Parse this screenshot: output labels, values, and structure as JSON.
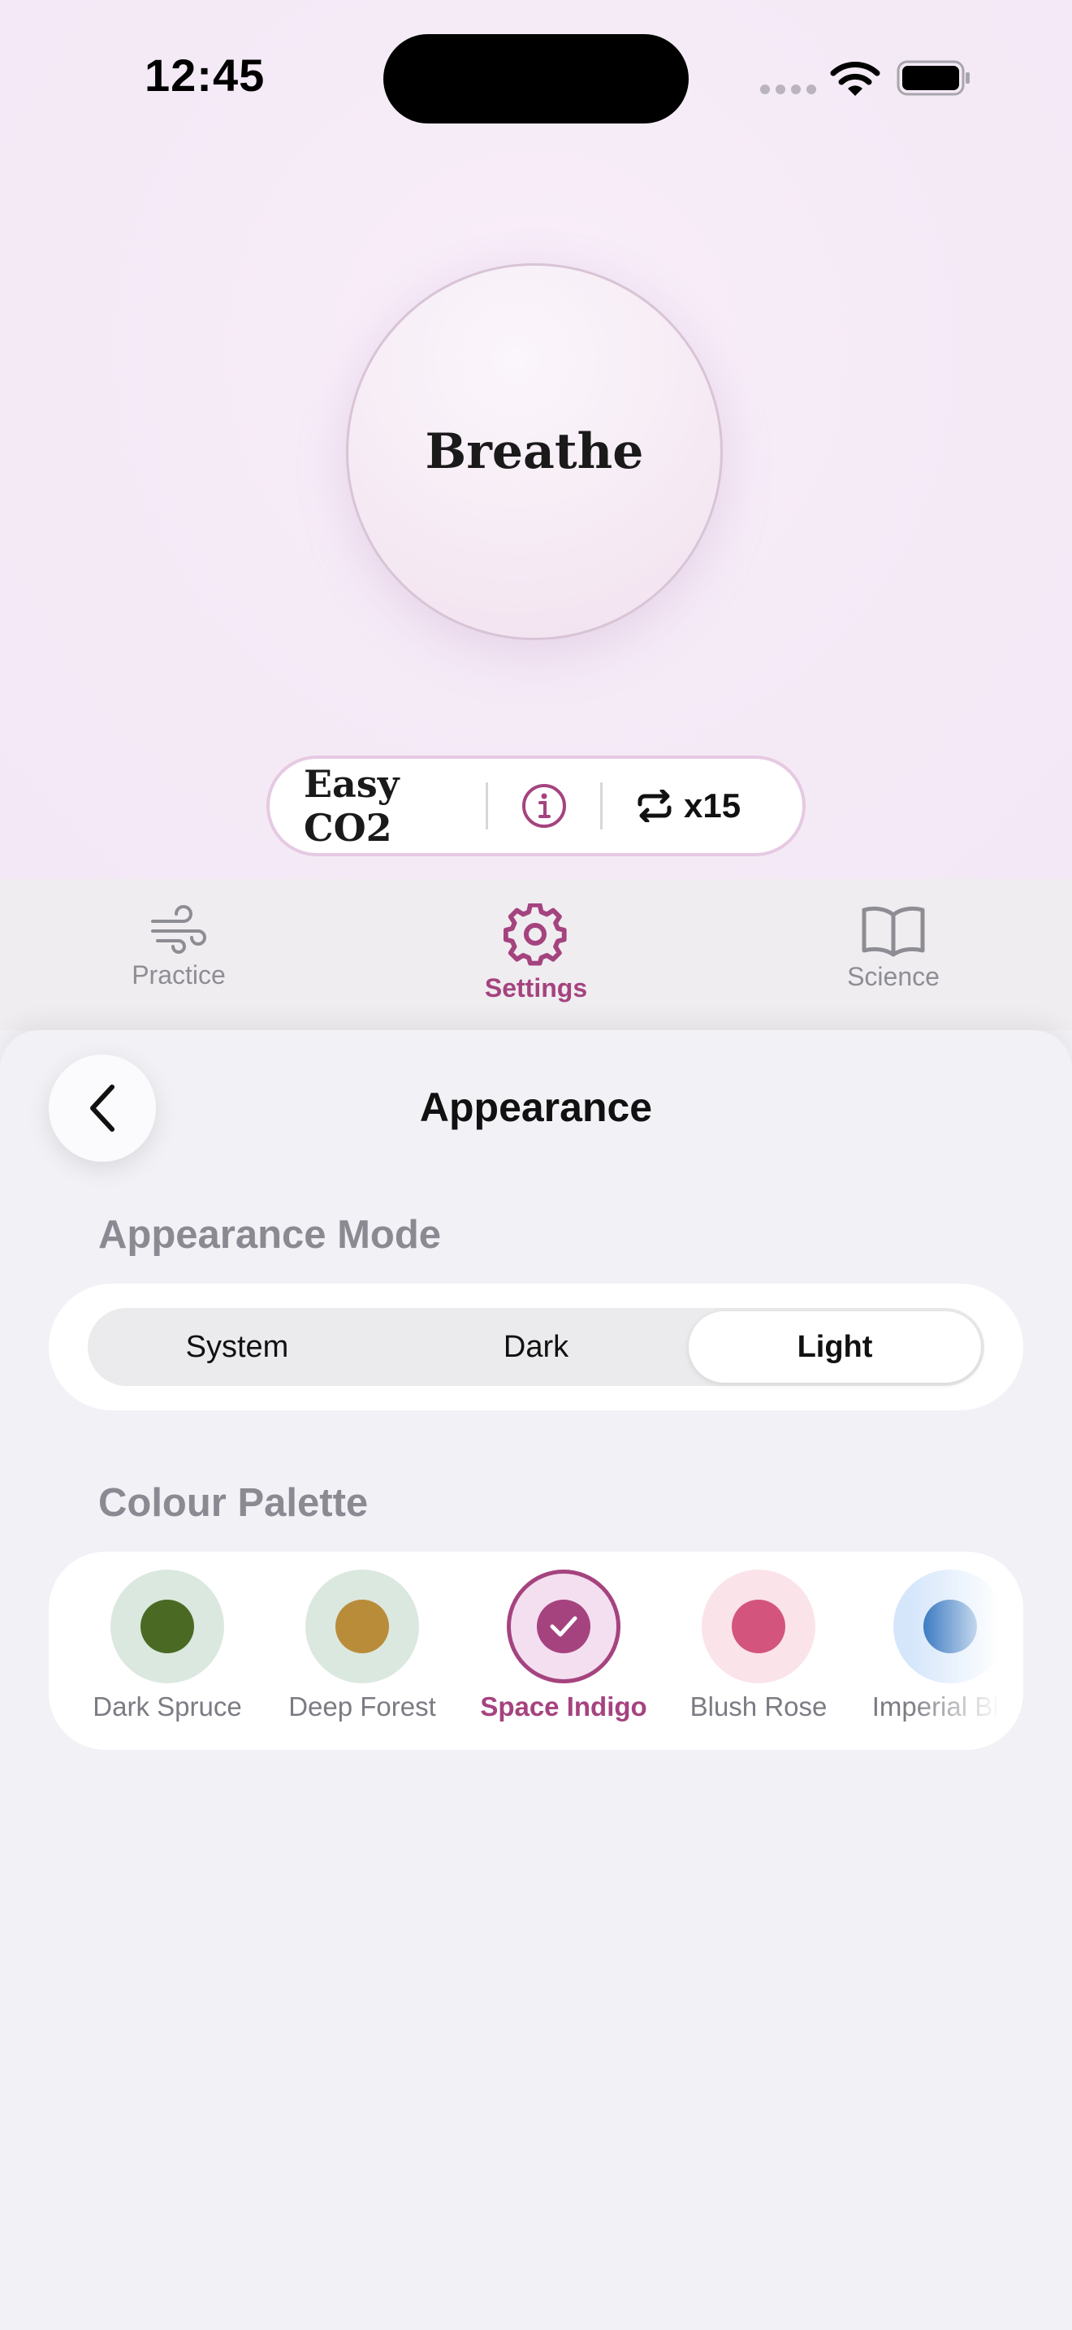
{
  "status_bar": {
    "time": "12:45"
  },
  "hero": {
    "breathe_label": "Breathe"
  },
  "mode_pill": {
    "exercise_name": "Easy CO2",
    "repeat_count": "x15"
  },
  "tab_bar": {
    "tabs": [
      {
        "label": "Practice",
        "icon": "wind-icon",
        "active": false
      },
      {
        "label": "Settings",
        "icon": "gear-icon",
        "active": true
      },
      {
        "label": "Science",
        "icon": "book-icon",
        "active": false
      }
    ]
  },
  "sheet": {
    "title": "Appearance",
    "appearance_mode": {
      "label": "Appearance Mode",
      "options": [
        "System",
        "Dark",
        "Light"
      ],
      "selected": "Light"
    },
    "colour_palette": {
      "label": "Colour Palette",
      "selected": "Space Indigo",
      "swatches": [
        {
          "name": "Dark Spruce",
          "color": "#4a6a24",
          "ring": "#dbe8df"
        },
        {
          "name": "Deep Forest",
          "color": "#b98c3a",
          "ring": "#dbe8df"
        },
        {
          "name": "Space Indigo",
          "color": "#a5437f",
          "ring": "#f4dff0"
        },
        {
          "name": "Blush Rose",
          "color": "#d3557d",
          "ring": "#fbe3ea"
        },
        {
          "name": "Imperial Blue",
          "color": "#1b64b8",
          "ring": "#d5e6fb"
        }
      ]
    }
  },
  "colors": {
    "accent": "#a5437f",
    "background": "#f2f1f6"
  }
}
